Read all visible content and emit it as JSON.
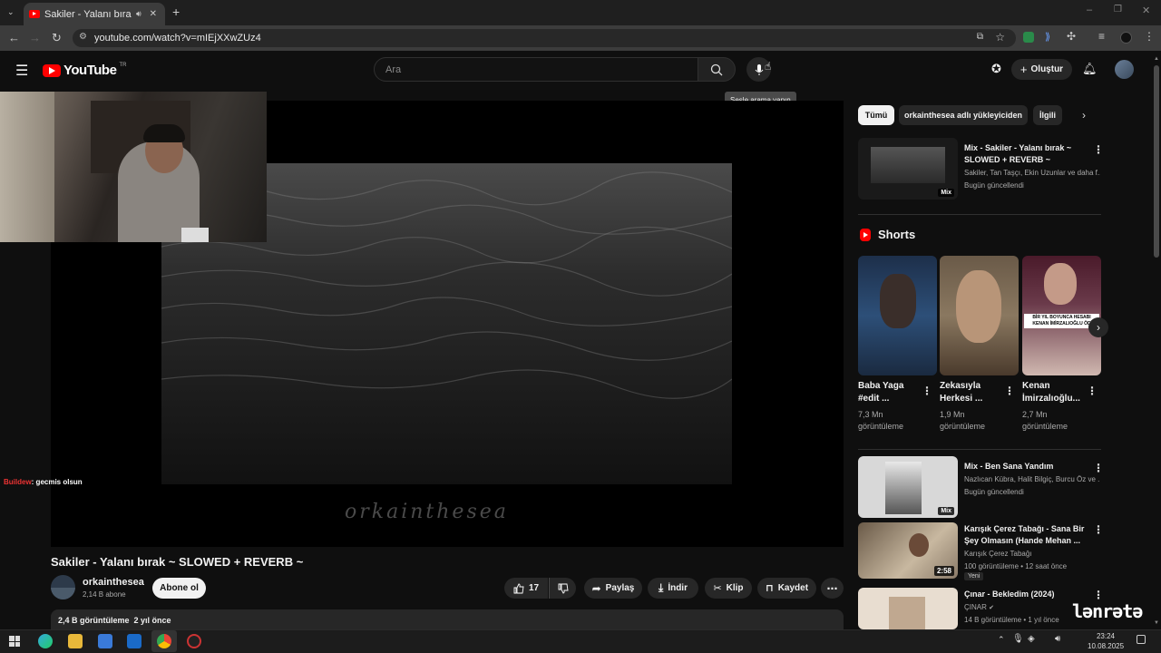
{
  "browser": {
    "tab_title": "Sakiler - Yalanı bırak ~ SLOW",
    "url": "youtube.com/watch?v=mIEjXXwZUz4"
  },
  "header": {
    "logo_text": "YouTube",
    "country_code": "TR",
    "search_placeholder": "Ara",
    "mic_tooltip": "Sesle arama yapın",
    "create_label": "Oluştur"
  },
  "video": {
    "watermark_text": "orkainthesea",
    "title": "Sakiler - Yalanı bırak ~ SLOWED + REVERB ~",
    "channel_name": "orkainthesea",
    "subscriber_count": "2,14 B abone",
    "subscribe_label": "Abone ol",
    "like_count": "17",
    "share_label": "Paylaş",
    "download_label": "İndir",
    "clip_label": "Klip",
    "save_label": "Kaydet",
    "description_stats": "2,4 B görüntüleme  2 yıl önce"
  },
  "chat": {
    "username": "Buildew",
    "message": ": gecmis olsun"
  },
  "filters": {
    "chips": [
      "Tümü",
      "orkainthesea adlı yükleyiciden",
      "İlgili"
    ]
  },
  "recommendations": [
    {
      "title": "Mix - Sakiler - Yalanı bırak ~ SLOWED + REVERB ~",
      "meta1": "Sakiler, Tan Taşçı, Ekin Uzunlar ve daha f...",
      "meta2": "Bugün güncellendi",
      "badge": "Mix"
    },
    {
      "title": "Mix - Ben Sana Yandım",
      "meta1": "Nazlıcan Kübra, Halit Bilgiç, Burcu Öz ve ...",
      "meta2": "Bugün güncellendi",
      "badge": "Mix"
    },
    {
      "title": "Karışık Çerez Tabağı - Sana Bir Şey Olmasın (Hande Mehan ...",
      "meta1": "Karışık Çerez Tabağı",
      "meta2": "100 görüntüleme • 12 saat önce",
      "badge": "2:58",
      "tag": "Yeni"
    },
    {
      "title": "Çınar - Bekledim (2024)",
      "meta1": "ÇINAR",
      "meta2": "14 B görüntüleme • 1 yıl önce"
    }
  ],
  "shorts": {
    "heading": "Shorts",
    "items": [
      {
        "title": "Baba Yaga #edit ...",
        "views": "7,3 Mn görüntüleme"
      },
      {
        "title": "Zekasıyla Herkesi ...",
        "views": "1,9 Mn görüntüleme"
      },
      {
        "title": "Kenan İmirzalıoğlu...",
        "views": "2,7 Mn görüntüleme"
      }
    ],
    "short3_overlay": "BİR YIL BOYUNCA HESABI KENAN İMİRZALIOĞLU ÖD"
  },
  "taskbar": {
    "time": "23:24",
    "date": "10.08.2025"
  },
  "overlay_watermark": "lənrətə"
}
